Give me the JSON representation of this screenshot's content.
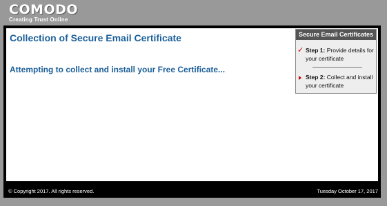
{
  "brand": {
    "name": "COMODO",
    "tagline": "Creating Trust Online"
  },
  "main": {
    "title": "Collection of Secure Email Certificate",
    "status": "Attempting to collect and install your Free Certificate..."
  },
  "steps_panel": {
    "header": "Secure Email Certificates",
    "steps": [
      {
        "label": "Step 1:",
        "text": "Provide details for your certificate",
        "icon": "check-icon",
        "state": "completed"
      },
      {
        "label": "Step 2:",
        "text": "Collect and install your certificate",
        "icon": "arrow-right-icon",
        "state": "current"
      }
    ]
  },
  "footer": {
    "copyright": "© Copyright 2017.  All rights reserved.",
    "date": "Tuesday October 17, 2017"
  },
  "colors": {
    "page_background": "#999999",
    "title_blue": "#1b5f99",
    "panel_header": "#555555",
    "step_marker": "#cc0000"
  }
}
